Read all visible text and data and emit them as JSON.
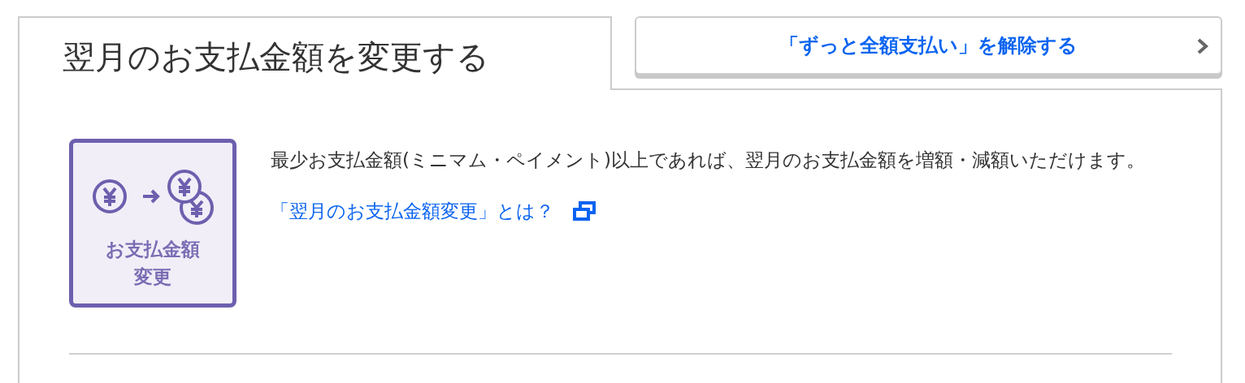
{
  "heading": "翌月のお支払金額を変更する",
  "action_button": {
    "label": "「ずっと全額支払い」を解除する"
  },
  "feature_tile": {
    "label_lines": [
      "お支払金額",
      "変更"
    ]
  },
  "description": "最少お支払金額(ミニマム・ペイメント)以上であれば、翌月のお支払金額を増額・減額いただけます。",
  "help_link": {
    "label": "「翌月のお支払金額変更」とは？",
    "opens_new_window": true
  }
}
